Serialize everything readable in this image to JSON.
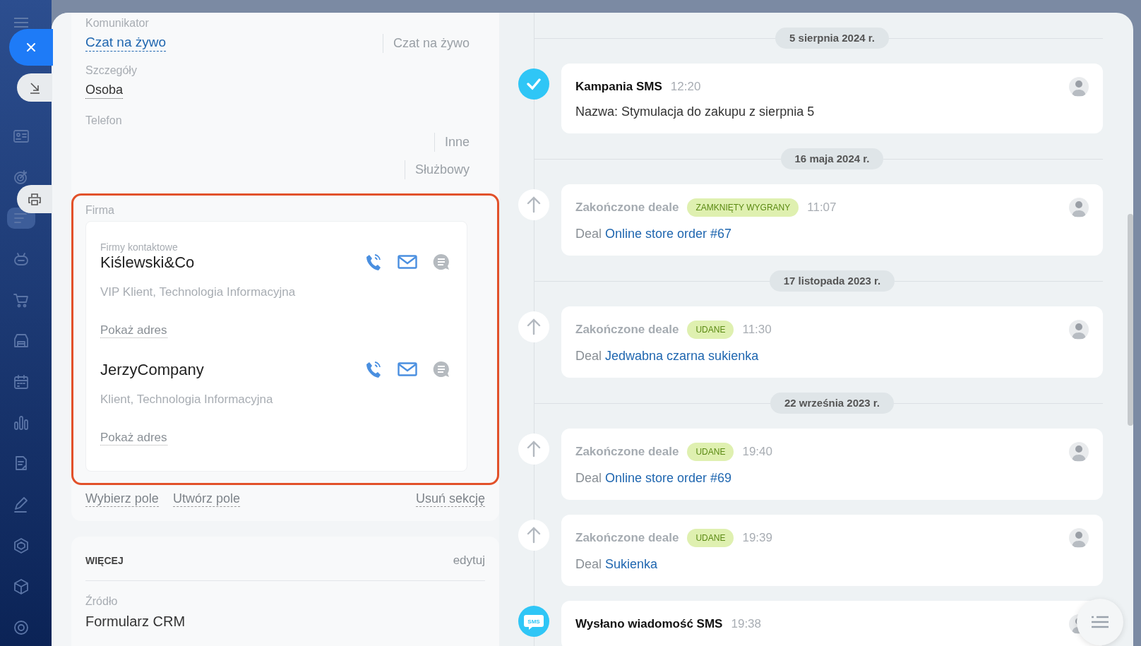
{
  "sidebar": {
    "items": [
      {
        "kind": "contacts",
        "selected": false
      },
      {
        "kind": "target",
        "selected": false
      },
      {
        "kind": "tasks",
        "selected": true
      },
      {
        "kind": "robot",
        "selected": false
      },
      {
        "kind": "cart",
        "selected": false
      },
      {
        "kind": "store",
        "selected": false
      },
      {
        "kind": "calendar",
        "selected": false
      },
      {
        "kind": "chart",
        "selected": false
      },
      {
        "kind": "doc",
        "selected": false
      },
      {
        "kind": "pen",
        "selected": false
      },
      {
        "kind": "hexagon",
        "selected": false
      },
      {
        "kind": "box",
        "selected": false
      },
      {
        "kind": "gear",
        "selected": false
      }
    ]
  },
  "floating_buttons": [
    {
      "kind": "close"
    },
    {
      "kind": "download"
    },
    {
      "kind": "print"
    }
  ],
  "fields": [
    {
      "label": "Komunikator",
      "kind": "link",
      "value": "Czat na żywo",
      "types": [
        "Czat na żywo"
      ]
    },
    {
      "label": "Szczegóły",
      "kind": "text",
      "value": "Osoba"
    },
    {
      "label": "Telefon",
      "kind": "phones",
      "types": [
        "Inne",
        "Służbowy"
      ]
    }
  ],
  "company_section": {
    "title": "Firma",
    "highlighted": true,
    "companies": [
      {
        "caption": "Firmy kontaktowe",
        "name": "Kiślewski&Co",
        "description": "VIP Klient, Technologia Informacyjna",
        "address_link": "Pokaż adres"
      },
      {
        "name": "JerzyCompany",
        "description": "Klient, Technologia Informacyjna",
        "address_link": "Pokaż adres"
      }
    ]
  },
  "section_actions": [
    "Wybierz pole",
    "Utwórz pole"
  ],
  "remove_section": "Usuń sekcję",
  "more_section": {
    "title": "WIĘCEJ",
    "edit": "edytuj",
    "fields": [
      {
        "label": "Źródło",
        "value": "Formularz CRM"
      }
    ]
  },
  "timeline": [
    {
      "kind": "date",
      "text": "5 sierpnia 2024 r."
    },
    {
      "kind": "check_event",
      "title": "Kampania SMS",
      "muted": false,
      "time": "12:20",
      "text": "Nazwa: Stymulacja do zakupu z sierpnia 5"
    },
    {
      "kind": "date",
      "text": "16 maja 2024 r."
    },
    {
      "kind": "deal_event",
      "title": "Zakończone deale",
      "muted": true,
      "badge": "ZAMKNIĘTY WYGRANY",
      "time": "11:07",
      "prefix": "Deal",
      "link": "Online store order #67"
    },
    {
      "kind": "date",
      "text": "17 listopada 2023 r."
    },
    {
      "kind": "deal_event",
      "title": "Zakończone deale",
      "muted": true,
      "badge": "UDANE",
      "time": "11:30",
      "prefix": "Deal",
      "link": "Jedwabna czarna sukienka"
    },
    {
      "kind": "date",
      "text": "22 września 2023 r."
    },
    {
      "kind": "deal_event",
      "title": "Zakończone deale",
      "muted": true,
      "badge": "UDANE",
      "time": "19:40",
      "prefix": "Deal",
      "link": "Online store order #69"
    },
    {
      "kind": "deal_event",
      "title": "Zakończone deale",
      "muted": true,
      "badge": "UDANE",
      "time": "19:39",
      "prefix": "Deal",
      "link": "Sukienka"
    },
    {
      "kind": "sms_event",
      "icon_text": "SMS",
      "title": "Wysłano wiadomość SMS",
      "muted": false,
      "time": "19:38"
    }
  ]
}
